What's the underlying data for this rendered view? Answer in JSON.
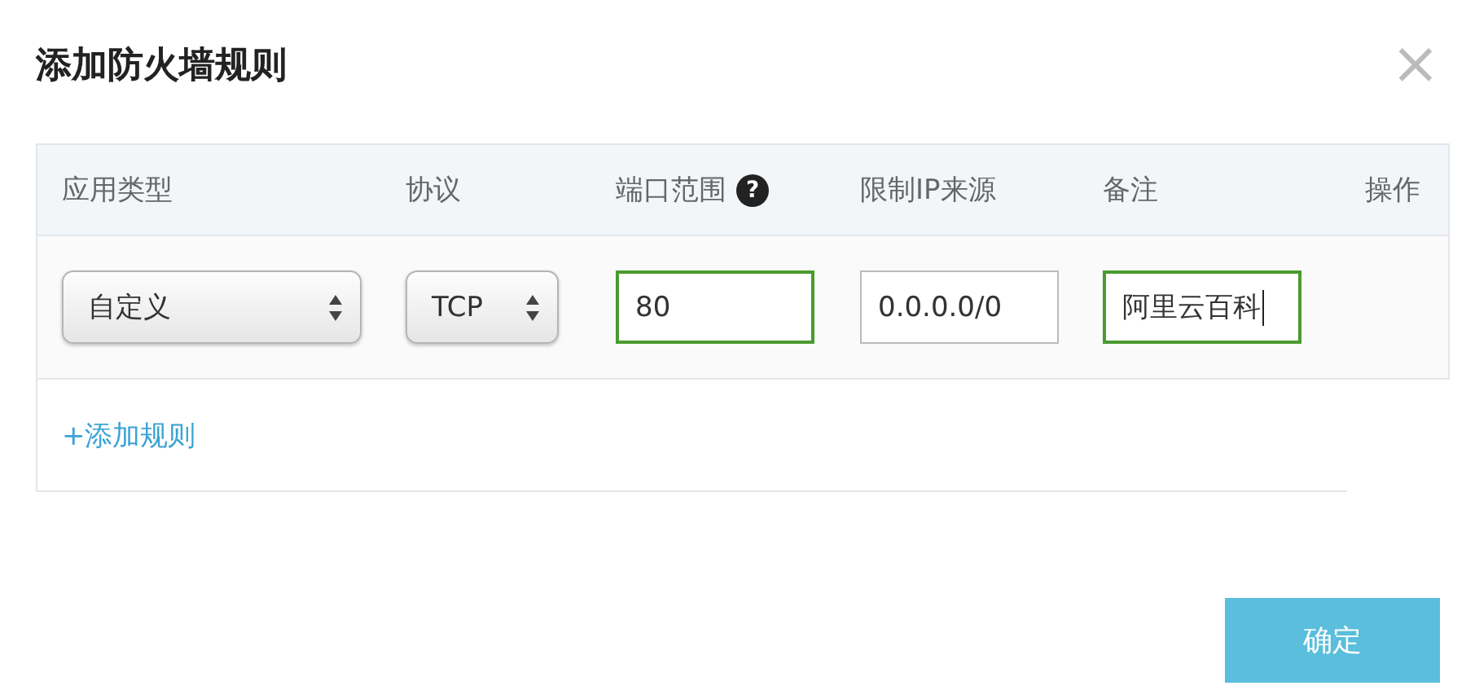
{
  "dialog": {
    "title": "添加防火墙规则",
    "close": "×"
  },
  "table": {
    "columns": [
      {
        "label": "应用类型"
      },
      {
        "label": "协议"
      },
      {
        "label": "端口范围",
        "help": "?"
      },
      {
        "label": "限制IP来源"
      },
      {
        "label": "备注"
      },
      {
        "label": "操作"
      }
    ],
    "rows": [
      {
        "cells": [
          {
            "kind": "select",
            "value": "自定义"
          },
          {
            "kind": "select",
            "value": "TCP"
          },
          {
            "kind": "input",
            "value": "80",
            "valid": true
          },
          {
            "kind": "input",
            "value": "0.0.0.0/0",
            "valid": false
          },
          {
            "kind": "input",
            "value": "阿里云百科",
            "valid": true,
            "focused": true
          }
        ]
      }
    ],
    "add_link": "+添加规则"
  },
  "confirm_button": "确定"
}
